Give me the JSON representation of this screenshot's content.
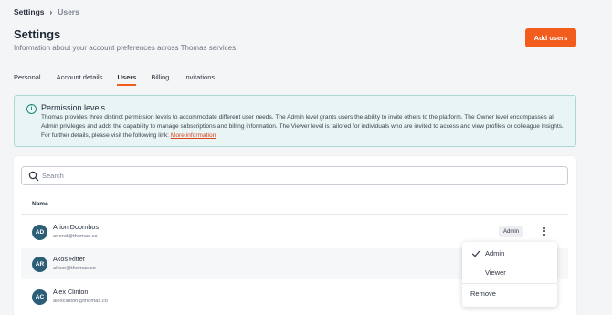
{
  "breadcrumb": {
    "home": "Settings",
    "separator": "›",
    "current": "Users"
  },
  "header": {
    "title": "Settings",
    "subtitle": "Information about your account preferences across Thomas services.",
    "add_button": "Add users"
  },
  "tabs": [
    {
      "label": "Personal",
      "active": false
    },
    {
      "label": "Account details",
      "active": false
    },
    {
      "label": "Users",
      "active": true
    },
    {
      "label": "Billing",
      "active": false
    },
    {
      "label": "Invitations",
      "active": false
    }
  ],
  "info": {
    "icon": "info-icon",
    "title": "Permission levels",
    "body": "Thomas provides three distinct permission levels to accommodate different user needs. The Admin level grants users the ability to invite others to the platform. The Owner level encompasses all Admin privileges and adds the capability to manage subscriptions and billing information. The Viewer level is tailored for individuals who are invited to access and view profiles or colleague insights. For further details, please visit the following link: ",
    "link": "More information"
  },
  "search": {
    "placeholder": "Search",
    "value": ""
  },
  "table": {
    "column_name": "Name",
    "rows": [
      {
        "initials": "AD",
        "name": "Arion Doornbos",
        "email": "ariond@thomas.co",
        "role": "Admin"
      },
      {
        "initials": "AR",
        "name": "Akos Ritter",
        "email": "akosr@thomas.co",
        "role": ""
      },
      {
        "initials": "AC",
        "name": "Alex Clinton",
        "email": "alexclinton@thomas.co",
        "role": ""
      }
    ]
  },
  "dropdown": {
    "options": [
      {
        "label": "Admin",
        "selected": true
      },
      {
        "label": "Viewer",
        "selected": false
      }
    ],
    "remove": "Remove"
  },
  "colors": {
    "accent": "#f25c1d",
    "avatar": "#2d5e78",
    "info_bg": "#e8f5f4",
    "info_border": "#a9d9d4",
    "link": "#d9441a"
  }
}
